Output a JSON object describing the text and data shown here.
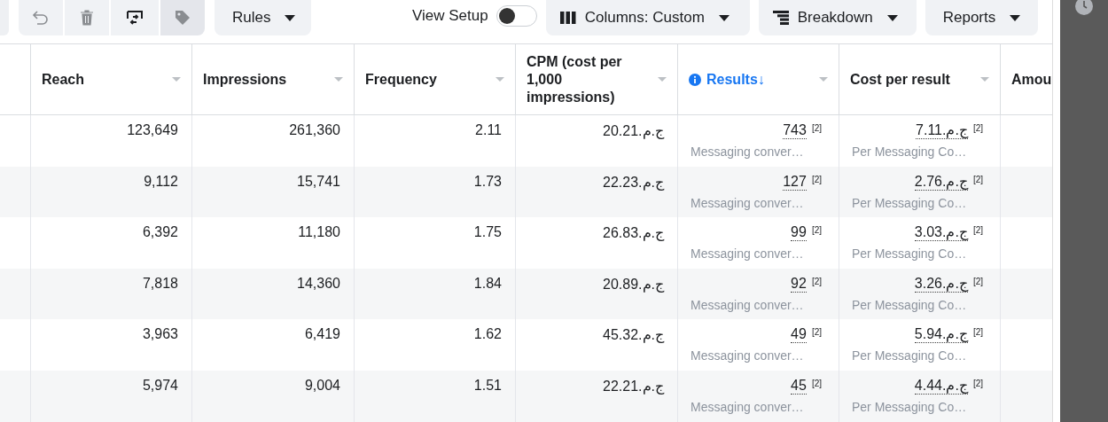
{
  "toolbar": {
    "icon_buttons": [
      {
        "kind": "undo",
        "disabled": true
      },
      {
        "kind": "delete",
        "disabled": true
      },
      {
        "kind": "swap",
        "disabled": false
      },
      {
        "kind": "tag",
        "disabled": true
      }
    ],
    "rules": {
      "label": "Rules"
    },
    "view_setup": {
      "label": "View Setup",
      "on": false
    },
    "menus": [
      {
        "kind": "columns",
        "label": "Columns: Custom"
      },
      {
        "kind": "breakdown",
        "label": "Breakdown"
      },
      {
        "kind": "reports",
        "label": "Reports"
      }
    ]
  },
  "table": {
    "columns": [
      {
        "label": "Reach",
        "sorted": false,
        "info": false
      },
      {
        "label": "Impressions",
        "sorted": false,
        "info": false
      },
      {
        "label": "Frequency",
        "sorted": false,
        "info": false
      },
      {
        "label": "CPM (cost per 1,000 impressions)",
        "sorted": false,
        "info": false
      },
      {
        "label": "Results",
        "sorted": true,
        "info": true,
        "sort_indicator": "↓"
      },
      {
        "label": "Cost per result",
        "sorted": false,
        "info": false
      },
      {
        "label": "Amou",
        "sorted": false,
        "info": false
      }
    ],
    "rows": [
      {
        "cells": [
          "123,649",
          "261,360",
          "2.11",
          "ج.م.20.21"
        ],
        "results": {
          "value": "743",
          "footnote": "[2]",
          "note": "Messaging conver…"
        },
        "cost": {
          "value": "ج.م.7.11",
          "footnote": "[2]",
          "note": "Per Messaging Co…"
        }
      },
      {
        "cells": [
          "9,112",
          "15,741",
          "1.73",
          "ج.م.22.23"
        ],
        "results": {
          "value": "127",
          "footnote": "[2]",
          "note": "Messaging conver…"
        },
        "cost": {
          "value": "ج.م.2.76",
          "footnote": "[2]",
          "note": "Per Messaging Co…"
        }
      },
      {
        "cells": [
          "6,392",
          "11,180",
          "1.75",
          "ج.م.26.83"
        ],
        "results": {
          "value": "99",
          "footnote": "[2]",
          "note": "Messaging conver…"
        },
        "cost": {
          "value": "ج.م.3.03",
          "footnote": "[2]",
          "note": "Per Messaging Co…"
        }
      },
      {
        "cells": [
          "7,818",
          "14,360",
          "1.84",
          "ج.م.20.89"
        ],
        "results": {
          "value": "92",
          "footnote": "[2]",
          "note": "Messaging conver…"
        },
        "cost": {
          "value": "ج.م.3.26",
          "footnote": "[2]",
          "note": "Per Messaging Co…"
        }
      },
      {
        "cells": [
          "3,963",
          "6,419",
          "1.62",
          "ج.م.45.32"
        ],
        "results": {
          "value": "49",
          "footnote": "[2]",
          "note": "Messaging conver…"
        },
        "cost": {
          "value": "ج.م.5.94",
          "footnote": "[2]",
          "note": "Per Messaging Co…"
        }
      },
      {
        "cells": [
          "5,974",
          "9,004",
          "1.51",
          "ج.م.22.21"
        ],
        "results": {
          "value": "45",
          "footnote": "[2]",
          "note": "Messaging conver…"
        },
        "cost": {
          "value": "ج.م.4.44",
          "footnote": "[2]",
          "note": "Per Messaging Co…"
        }
      }
    ]
  }
}
